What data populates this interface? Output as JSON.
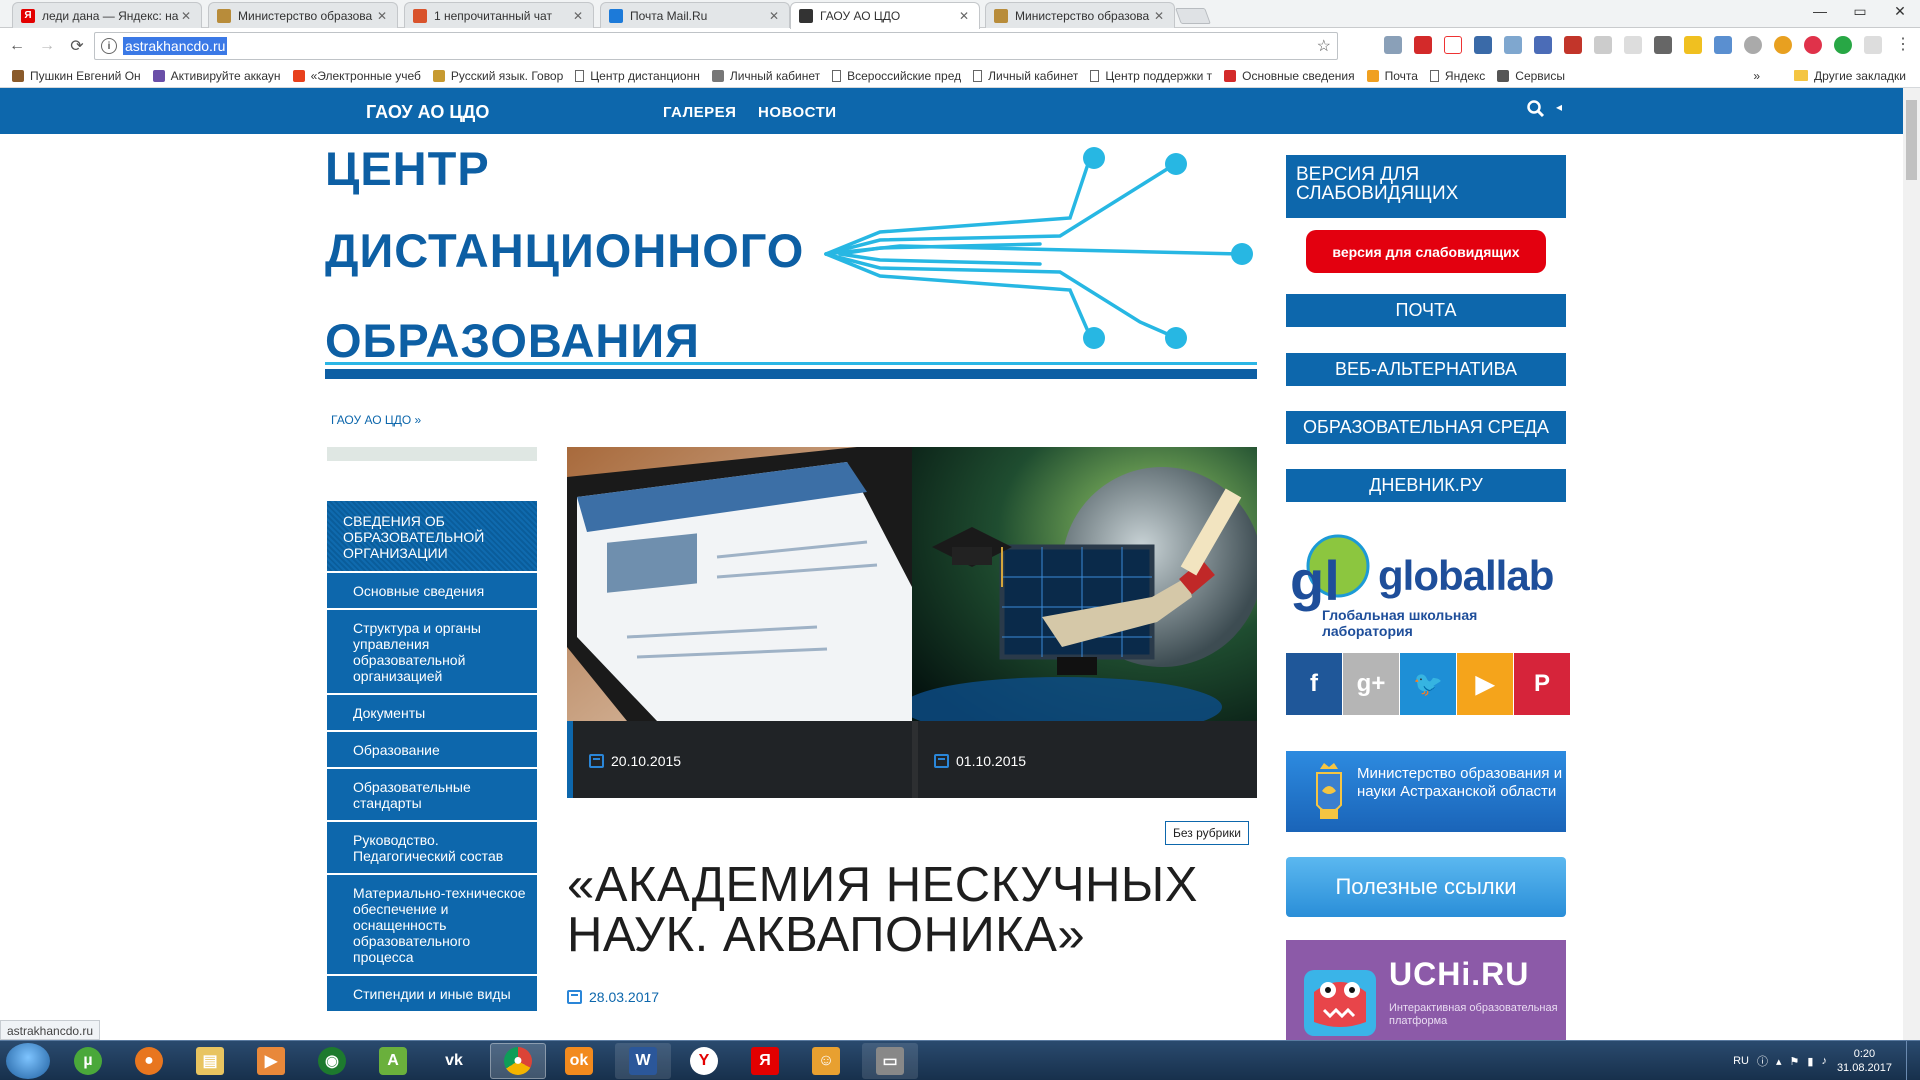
{
  "browser": {
    "tabs": [
      {
        "title": "леди дана — Яндекс: на",
        "fav": "Я",
        "color": "#e30000",
        "active": false
      },
      {
        "title": "Министерство образова",
        "fav": "",
        "color": "#b88c3a",
        "active": false
      },
      {
        "title": "1 непрочитанный чат",
        "fav": "",
        "color": "#d9532c",
        "active": false
      },
      {
        "title": "Почта Mail.Ru",
        "fav": "",
        "color": "#1c7ad9",
        "active": false
      },
      {
        "title": "ГАОУ АО ЦДО",
        "fav": "",
        "color": "#333333",
        "active": true
      },
      {
        "title": "Министерство образова",
        "fav": "",
        "color": "#b88c3a",
        "active": false
      }
    ],
    "url": "astrakhancdo.ru",
    "status_url": "astrakhancdo.ru",
    "bookmarks": [
      {
        "label": "Сервисы",
        "icon": "apps-icon"
      },
      {
        "label": "Яндекс",
        "icon": "page-icon"
      },
      {
        "label": "Почта",
        "icon": "mail-icon"
      },
      {
        "label": "Основные сведения",
        "icon": "red-icon"
      },
      {
        "label": "Центр поддержки т",
        "icon": "page-icon"
      },
      {
        "label": "Личный кабинет",
        "icon": "page-icon"
      },
      {
        "label": "Всероссийские пред",
        "icon": "page-icon"
      },
      {
        "label": "Личный кабинет",
        "icon": "feather-icon"
      },
      {
        "label": "Центр дистанционн",
        "icon": "page-icon"
      },
      {
        "label": "Русский язык. Говор",
        "icon": "g-icon"
      },
      {
        "label": "«Электронные учеб",
        "icon": "joomla-icon"
      },
      {
        "label": "Активируйте аккаун",
        "icon": "pen-icon"
      },
      {
        "label": "Пушкин Евгений Он",
        "icon": "horse-icon"
      }
    ],
    "bookmarks_more": "»",
    "other_bookmarks": "Другие закладки"
  },
  "site": {
    "brand": "ГАОУ АО ЦДО",
    "menu": [
      "ГАЛЕРЕЯ",
      "НОВОСТИ"
    ],
    "logo_lines": [
      "ЦЕНТР",
      "ДИСТАНЦИОННОГО",
      "ОБРАЗОВАНИЯ"
    ],
    "breadcrumb": "ГАОУ АО ЦДО »",
    "sidebar_head": "СВЕДЕНИЯ ОБ ОБРАЗОВАТЕЛЬНОЙ ОРГАНИЗАЦИИ",
    "sidebar_items": [
      "Основные сведения",
      "Структура и органы управления образовательной организацией",
      "Документы",
      "Образование",
      "Образовательные стандарты",
      "Руководство. Педагогический состав",
      "Материально-техническое обеспечение и оснащенность образовательного процесса",
      "Стипендии и иные виды"
    ],
    "slides": [
      {
        "date": "20.10.2015"
      },
      {
        "date": "01.10.2015"
      }
    ],
    "category": "Без рубрики",
    "post_title": "«АКАДЕМИЯ НЕСКУЧНЫХ НАУК. АКВАПОНИКА»",
    "post_date": "28.03.2017",
    "right": {
      "accessibility_head": "ВЕРСИЯ ДЛЯ СЛАБОВИДЯЩИХ",
      "accessibility_button": "версия для слабовидящих",
      "links": [
        "ПОЧТА",
        "ВЕБ-АЛЬТЕРНАТИВА",
        "ОБРАЗОВАТЕЛЬНАЯ СРЕДА",
        "ДНЕВНИК.РУ"
      ],
      "globallab_name": "globallab",
      "globallab_sub": "Глобальная школьная лаборатория",
      "social": [
        {
          "name": "facebook-icon",
          "glyph": "f",
          "color": "#1f5799"
        },
        {
          "name": "google-plus-icon",
          "glyph": "g+",
          "color": "#b5b5b5"
        },
        {
          "name": "twitter-icon",
          "glyph": "🐦",
          "color": "#1e8fd6"
        },
        {
          "name": "youtube-icon",
          "glyph": "▶",
          "color": "#f5a41b"
        },
        {
          "name": "pinterest-icon",
          "glyph": "P",
          "color": "#d6243a"
        }
      ],
      "ministry": "Министерство образования и науки Астраханской области",
      "useful_links": "Полезные ссылки",
      "uchi_name": "UCHi.RU",
      "uchi_sub": "Интерактивная образовательная платформа"
    }
  },
  "taskbar": {
    "lang": "RU",
    "time": "0:20",
    "date": "31.08.2017"
  }
}
